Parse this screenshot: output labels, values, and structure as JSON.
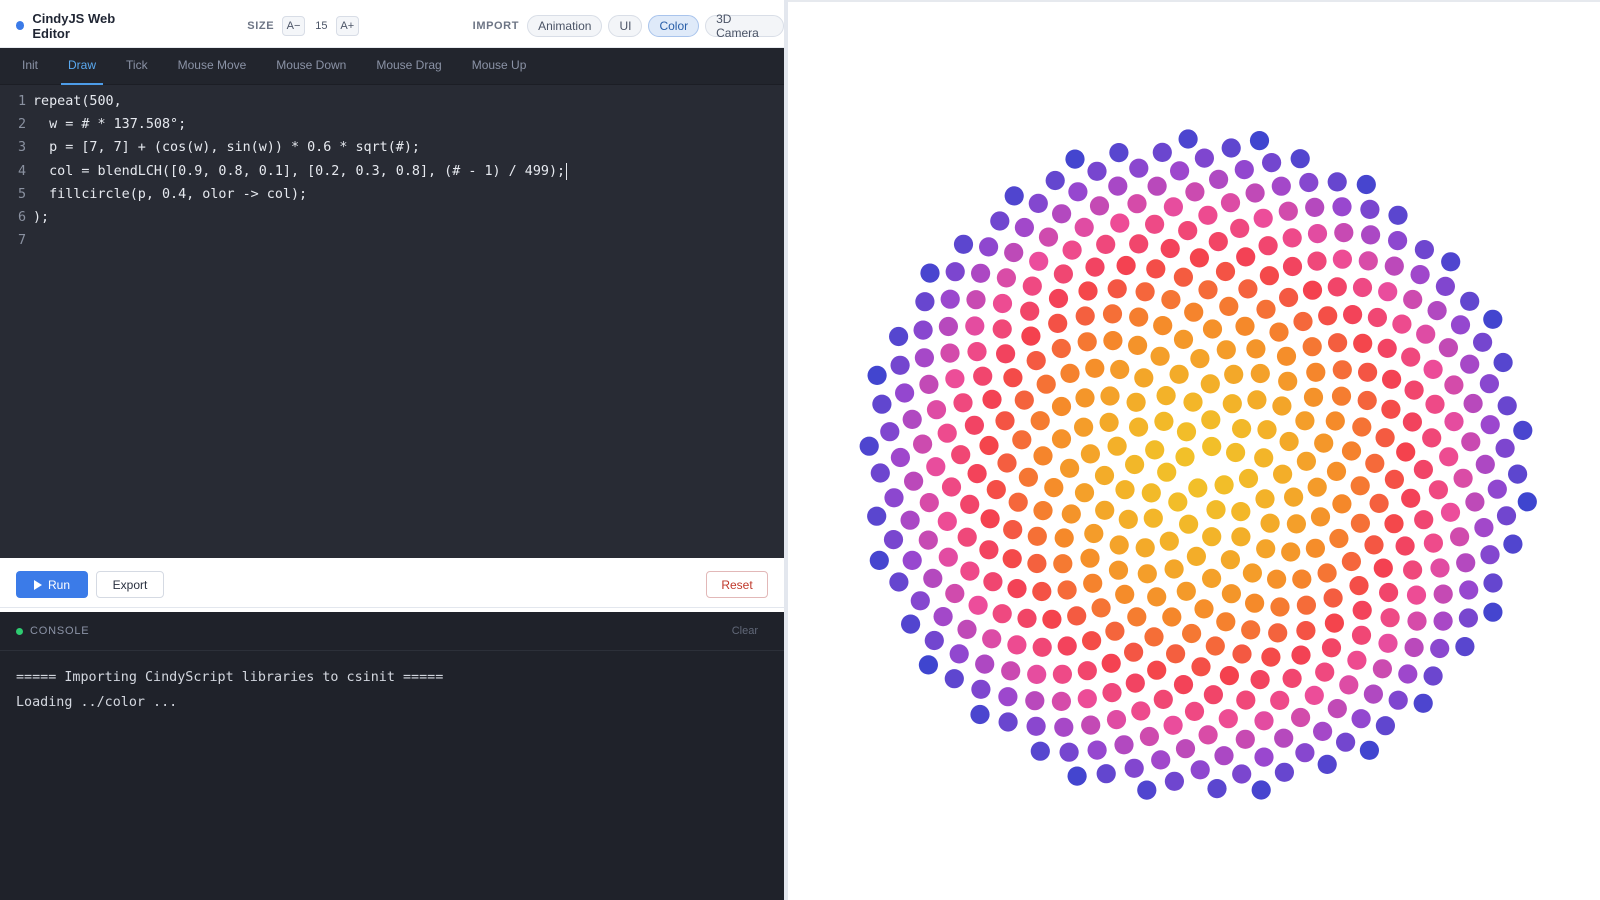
{
  "app": {
    "title": "CindyJS Web Editor"
  },
  "size": {
    "label": "SIZE",
    "decrease_label": "A−",
    "value": "15",
    "increase_label": "A+"
  },
  "import": {
    "label": "IMPORT",
    "options": [
      "Animation",
      "UI",
      "Color",
      "3D Camera"
    ],
    "active": "Color"
  },
  "tabs": [
    "Init",
    "Draw",
    "Tick",
    "Mouse Move",
    "Mouse Down",
    "Mouse Drag",
    "Mouse Up"
  ],
  "active_tab": "Draw",
  "code": [
    "repeat(500,",
    "  w = # * 137.508°;",
    "  p = [7, 7] + (cos(w), sin(w)) * 0.6 * sqrt(#);",
    "  col = blendLCH([0.9, 0.8, 0.1], [0.2, 0.3, 0.8], (# - 1) / 499);",
    "  fillcircle(p, 0.4, olor -> col);",
    ");",
    ""
  ],
  "line_numbers": [
    "1",
    "2",
    "3",
    "4",
    "5",
    "6",
    "7"
  ],
  "actions": {
    "run_label": "Run",
    "export_label": "Export",
    "reset_label": "Reset"
  },
  "console": {
    "title": "CONSOLE",
    "clear_label": "Clear",
    "lines": [
      "===== Importing CindyScript libraries to csinit =====",
      "Loading ../color ..."
    ]
  },
  "colors": {
    "accent": "#3b7be8",
    "console_status": "#2ecc71",
    "gradient_start": "#f2c029",
    "gradient_mid1": "#f5892a",
    "gradient_mid2": "#f4414e",
    "gradient_mid3": "#ec4d9b",
    "gradient_mid4": "#9a47cf",
    "gradient_end": "#3e45cf"
  },
  "canvas": {
    "point_count": 500,
    "divergence_angle_deg": 137.508
  }
}
